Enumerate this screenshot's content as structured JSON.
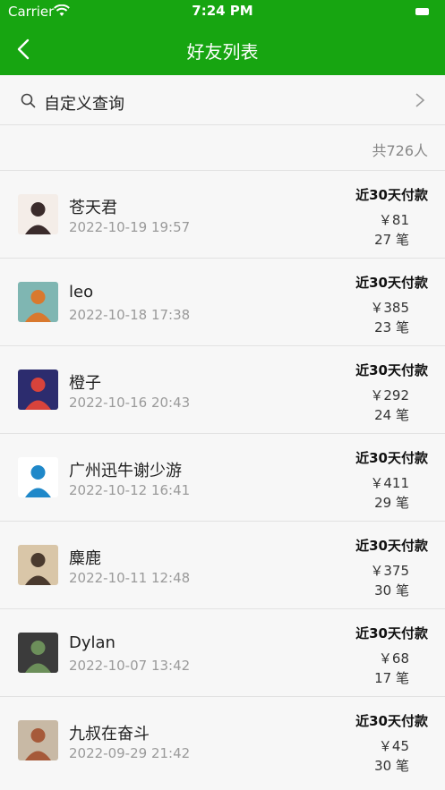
{
  "status_bar": {
    "carrier": "Carrier",
    "time": "7:24 PM"
  },
  "nav": {
    "title": "好友列表"
  },
  "search": {
    "label": "自定义查询"
  },
  "summary": {
    "count_text": "共726人"
  },
  "friends": [
    {
      "name": "苍天君",
      "time": "2022-10-19 19:57",
      "pay_label": "近30天付款",
      "amount": "￥81",
      "count": "27 笔",
      "avatar_colors": [
        "#f4ede8",
        "#3a2b2b"
      ]
    },
    {
      "name": "leo",
      "time": "2022-10-18 17:38",
      "pay_label": "近30天付款",
      "amount": "￥385",
      "count": "23 笔",
      "avatar_colors": [
        "#7fb6b2",
        "#d9792e"
      ]
    },
    {
      "name": "橙子",
      "time": "2022-10-16 20:43",
      "pay_label": "近30天付款",
      "amount": "￥292",
      "count": "24 笔",
      "avatar_colors": [
        "#2c2c6e",
        "#d8433b"
      ]
    },
    {
      "name": "广州迅牛谢少游",
      "time": "2022-10-12 16:41",
      "pay_label": "近30天付款",
      "amount": "￥411",
      "count": "29 笔",
      "avatar_colors": [
        "#ffffff",
        "#1f88c9"
      ]
    },
    {
      "name": "麋鹿",
      "time": "2022-10-11 12:48",
      "pay_label": "近30天付款",
      "amount": "￥375",
      "count": "30 笔",
      "avatar_colors": [
        "#d9c6a8",
        "#4a3a2e"
      ]
    },
    {
      "name": "Dylan",
      "time": "2022-10-07 13:42",
      "pay_label": "近30天付款",
      "amount": "￥68",
      "count": "17 笔",
      "avatar_colors": [
        "#3b3b3b",
        "#6c8f5a"
      ]
    },
    {
      "name": "九叔在奋斗",
      "time": "2022-09-29 21:42",
      "pay_label": "近30天付款",
      "amount": "￥45",
      "count": "30 笔",
      "avatar_colors": [
        "#c8b9a5",
        "#a65a3a"
      ]
    }
  ],
  "colors": {
    "header_green": "#17a511",
    "background": "#f7f7f7",
    "divider": "#e2e2e2"
  }
}
